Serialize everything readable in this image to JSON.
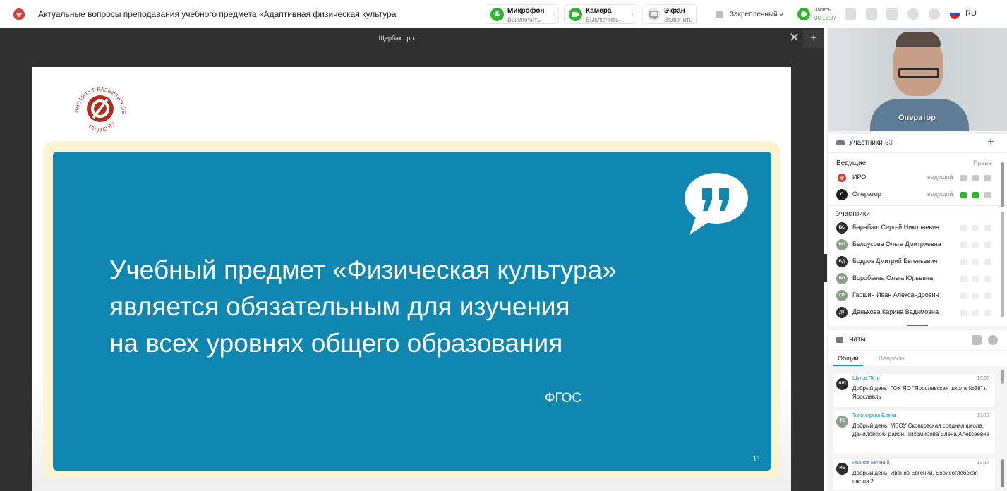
{
  "header": {
    "title": "Актуальные вопросы преподавания учебного предмета «Адаптивная физическая культура",
    "mic": {
      "label": "Микрофон",
      "sub": "Выключить",
      "color": "#2eb52e"
    },
    "camera": {
      "label": "Камера",
      "sub": "Выключить",
      "color": "#2eb52e"
    },
    "screen": {
      "label": "Экран",
      "sub": "Включить"
    },
    "pinned": "Закрепленный",
    "record": {
      "label": "Запись",
      "time": "00:13:27"
    },
    "language": "RU"
  },
  "stage": {
    "file_name": "Щербак.pptx",
    "slide": {
      "quote_lines": [
        "Учебный предмет «Физическая культура»",
        "является обязательным для изучения",
        "на всех уровнях общего образования"
      ],
      "source": "ФГОС",
      "page_number": "11",
      "logo_text": "ИНСТИТУТ РАЗВИТИЯ ОБРАЗОВАНИЯ · ГАУ ДПО ЯО",
      "colors": {
        "panel": "#0f87b0",
        "frame": "#fbf3d2",
        "seal": "#b22b1e"
      }
    }
  },
  "video": {
    "name": "Оператор"
  },
  "participants": {
    "title": "Участники",
    "count": "33",
    "hosts_label": "Ведущие",
    "rights_label": "Права",
    "hosts": [
      {
        "name": "ИРО",
        "role": "ведущий",
        "initials": "",
        "avatar": "logo"
      },
      {
        "name": "Оператор",
        "role": "ведущий",
        "initials": "О",
        "avatar": "#1f1f1f"
      }
    ],
    "members_label": "Участники",
    "members": [
      {
        "initials": "БС",
        "name": "Барабаш Сергей Николаевич",
        "color": "#2b2b2b"
      },
      {
        "initials": "БО",
        "name": "Белоусова Ольга Дмитриевна",
        "color": "#8fa08a"
      },
      {
        "initials": "БД",
        "name": "Бодров Дмитрий Евгеньевич",
        "color": "#2b2b2b"
      },
      {
        "initials": "ВО",
        "name": "Воробьева Ольга Юрьевна",
        "color": "#8fa08a"
      },
      {
        "initials": "ГИ",
        "name": "Гаршин Иван Александрович",
        "color": "#8fa08a"
      },
      {
        "initials": "ДК",
        "name": "Данькова Карина Вадимовна",
        "color": "#2b2b2b"
      }
    ]
  },
  "chat": {
    "title": "Чаты",
    "tabs": [
      {
        "label": "Общий"
      },
      {
        "label": "Вопросы"
      }
    ],
    "messages": [
      {
        "initials": "ШП",
        "color": "#2b2b2b",
        "author": "Шутов Пётр",
        "time": "13:06",
        "text": "Добрый день! ГОУ ЯО \"Ярославская школа №38\" г. Ярославль"
      },
      {
        "initials": "ТЕ",
        "color": "#8fa08a",
        "author": "Тихомирова Елена",
        "time": "13:12",
        "text": "Добрый день. МБОУ Сковковская средняя школа. Даниловский район. Тихомирова Елена Алексеевна"
      },
      {
        "initials": "ИЕ",
        "color": "#2b2b2b",
        "author": "Иванов Евгений",
        "time": "13:13",
        "text": "Добрый день. Иванов Евгений. Борисоглебская школа 2"
      }
    ]
  }
}
